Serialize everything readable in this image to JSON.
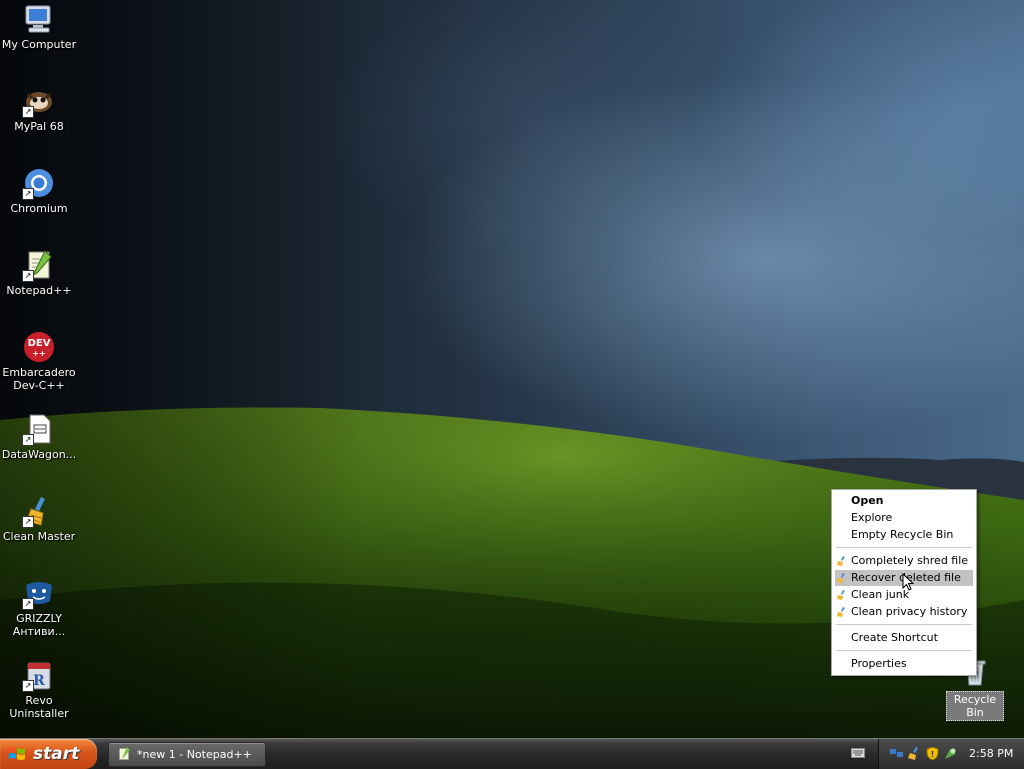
{
  "desktop": {
    "icons": [
      {
        "label": "My Computer",
        "icon": "my-computer-icon"
      },
      {
        "label": "MyPal 68",
        "icon": "mypal-icon"
      },
      {
        "label": "Chromium",
        "icon": "chromium-icon"
      },
      {
        "label": "Notepad++",
        "icon": "notepad-plus-plus-icon"
      },
      {
        "label_line1": "Embarcadero",
        "label_line2": "Dev-C++",
        "icon": "dev-cpp-icon",
        "icon_text": "DEV"
      },
      {
        "label": "DataWagon...",
        "icon": "datawagon-icon"
      },
      {
        "label": "Clean Master",
        "icon": "clean-master-icon"
      },
      {
        "label_line1": "GRIZZLY",
        "label_line2": "Антиви...",
        "icon": "grizzly-icon"
      },
      {
        "label_line1": "Revo",
        "label_line2": "Uninstaller",
        "icon": "revo-uninstaller-icon"
      }
    ],
    "recycle_bin": {
      "label": "Recycle Bin",
      "icon": "recycle-bin-icon"
    }
  },
  "context_menu": {
    "items": [
      {
        "label": "Open",
        "bold": true
      },
      {
        "label": "Explore"
      },
      {
        "label": "Empty Recycle Bin"
      },
      {
        "label": "Completely shred file",
        "icon": "clean-master-brush-icon"
      },
      {
        "label": "Recover deleted file",
        "icon": "clean-master-brush-icon",
        "highlighted": true
      },
      {
        "label": "Clean junk",
        "icon": "clean-master-brush-icon"
      },
      {
        "label": "Clean privacy history",
        "icon": "clean-master-brush-icon"
      },
      {
        "label": "Create Shortcut"
      },
      {
        "label": "Properties"
      }
    ]
  },
  "taskbar": {
    "start_label": "start",
    "tasks": [
      {
        "label": "*new 1 - Notepad++",
        "icon": "notepad-plus-plus-icon"
      }
    ],
    "tray_icons": [
      "network-icon",
      "clean-master-icon",
      "security-shield-icon",
      "app-tray-icon"
    ],
    "clock": "2:58 PM"
  },
  "colors": {
    "start_orange": "#d8541a",
    "menu_highlight": "#c2c2c2",
    "taskbar_dark": "#262626"
  }
}
